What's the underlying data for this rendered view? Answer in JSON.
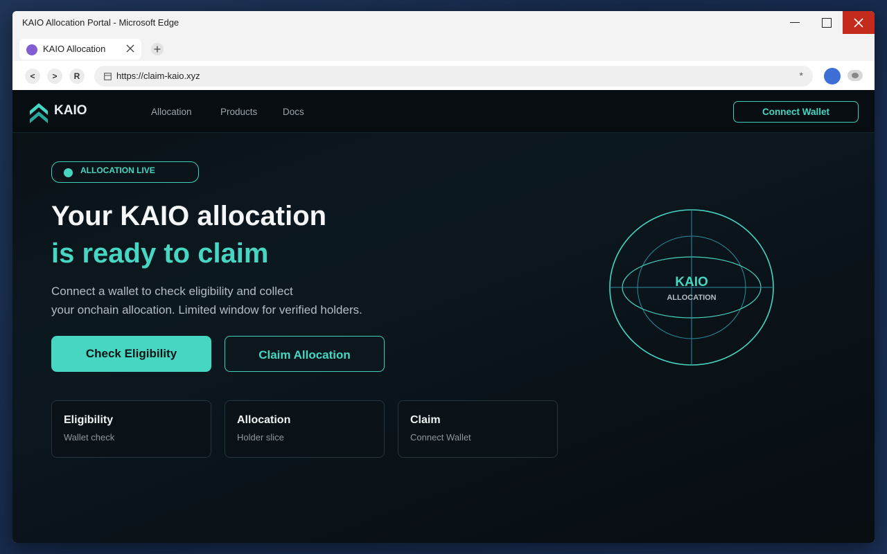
{
  "window": {
    "title": "KAIO Allocation Portal - Microsoft Edge"
  },
  "tabs": [
    {
      "label": "KAIO Allocation"
    }
  ],
  "toolbar": {
    "back_label": "<",
    "forward_label": ">",
    "reload_label": "R",
    "url": "https://claim-kaio.xyz",
    "star_label": "*"
  },
  "site": {
    "brand": "KAIO",
    "nav": [
      "Allocation",
      "Products",
      "Docs"
    ],
    "connect_label": "Connect Wallet"
  },
  "hero": {
    "badge": "ALLOCATION LIVE",
    "title_line1": "Your KAIO allocation",
    "title_line2": "is ready to claim",
    "desc_line1": "Connect a wallet to check eligibility and collect",
    "desc_line2": "your onchain allocation. Limited window for verified holders.",
    "primary_button": "Check Eligibility",
    "secondary_button": "Claim Allocation"
  },
  "cards": [
    {
      "title": "Eligibility",
      "subtitle": "Wallet check"
    },
    {
      "title": "Allocation",
      "subtitle": "Holder slice"
    },
    {
      "title": "Claim",
      "subtitle": "Connect Wallet"
    }
  ],
  "globe": {
    "title": "KAIO",
    "subtitle": "ALLOCATION"
  },
  "colors": {
    "accent": "#46d6c1",
    "background": "#0a1218",
    "close_button": "#c42b1c",
    "favicon": "#7f5fd1",
    "profile": "#3d6fd6"
  },
  "icons": [
    "minimize-icon",
    "maximize-icon",
    "close-icon",
    "tab-close-icon",
    "plus-icon",
    "page-icon",
    "star-icon",
    "kaio-logo-icon",
    "status-dot-icon"
  ]
}
